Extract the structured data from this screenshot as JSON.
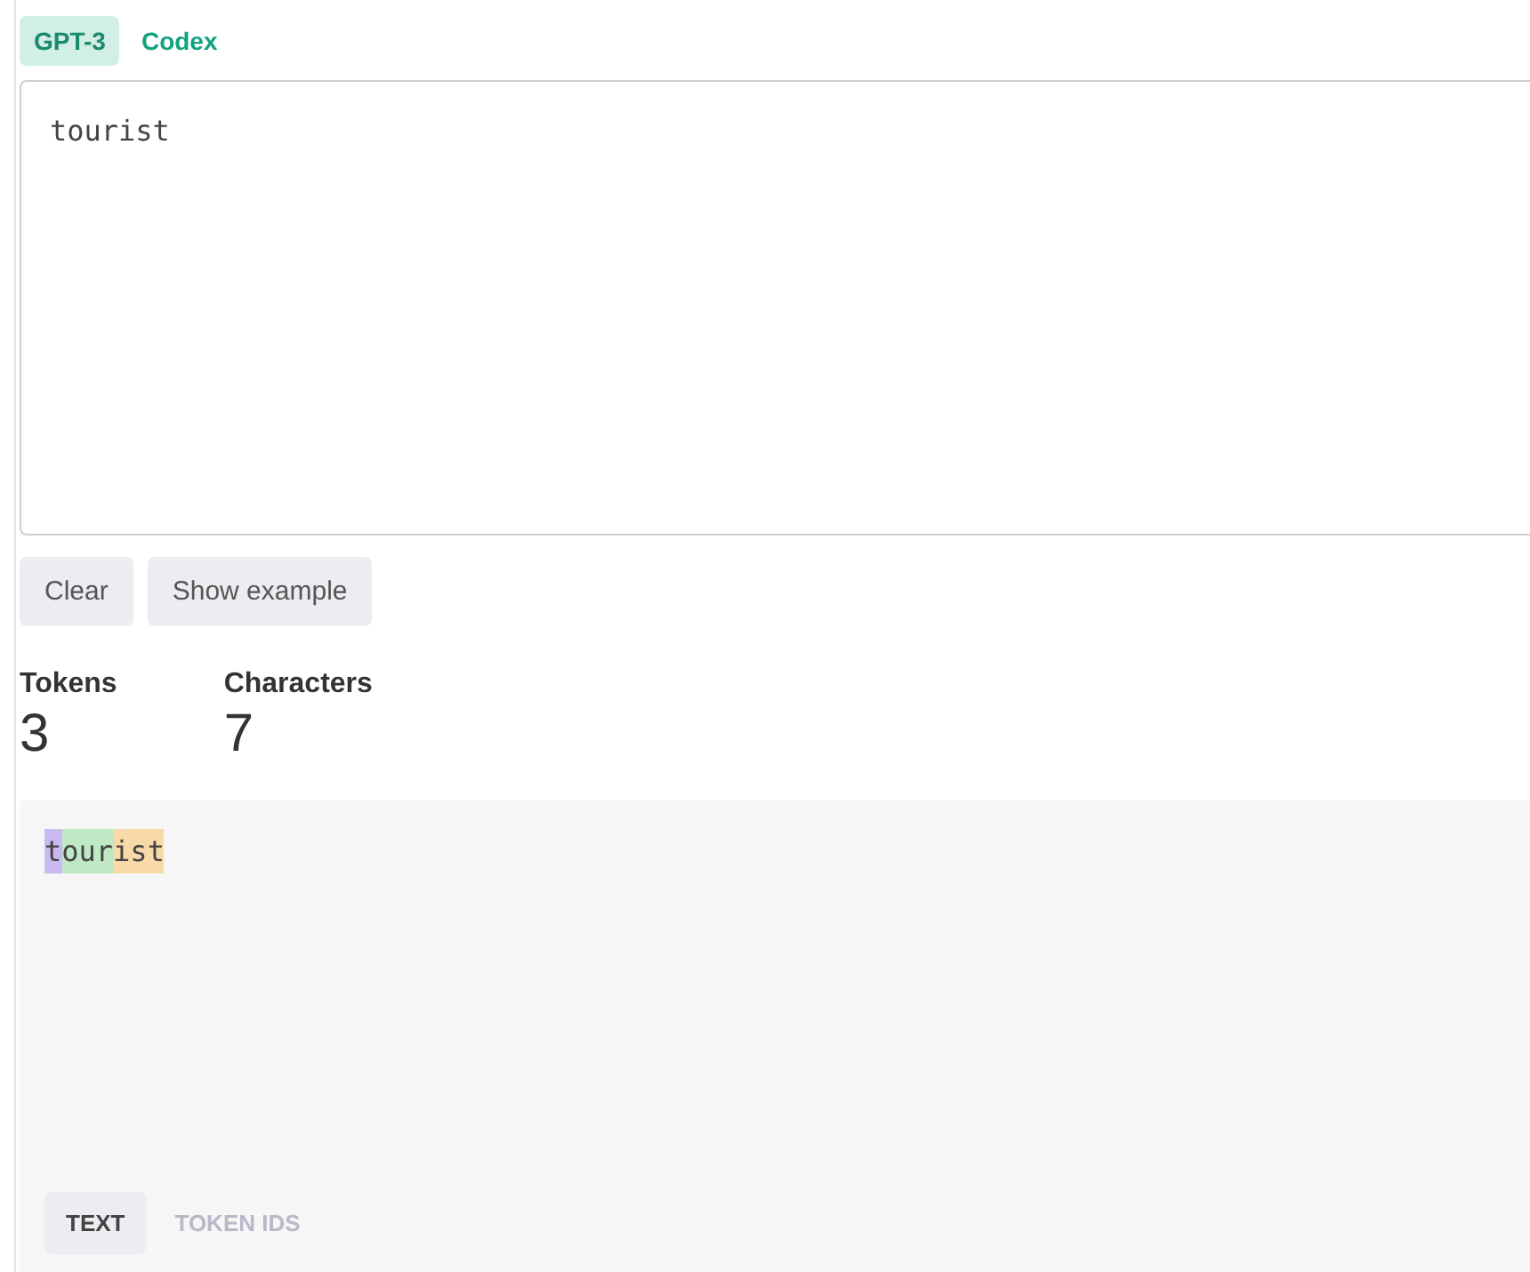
{
  "model_tabs": [
    {
      "label": "GPT-3",
      "selected": true
    },
    {
      "label": "Codex",
      "selected": false
    }
  ],
  "input": {
    "value": "tourist"
  },
  "buttons": [
    "Clear",
    "Show example"
  ],
  "stats": [
    {
      "label": "Tokens",
      "value": "3"
    },
    {
      "label": "Characters",
      "value": "7"
    }
  ],
  "tokens": [
    {
      "text": "t",
      "color": "#c9b9f0"
    },
    {
      "text": "our",
      "color": "#bfe8c4"
    },
    {
      "text": "ist",
      "color": "#f8d9a8"
    }
  ],
  "view_tabs": [
    {
      "label": "TEXT",
      "selected": true
    },
    {
      "label": "TOKEN IDS",
      "selected": false
    }
  ]
}
